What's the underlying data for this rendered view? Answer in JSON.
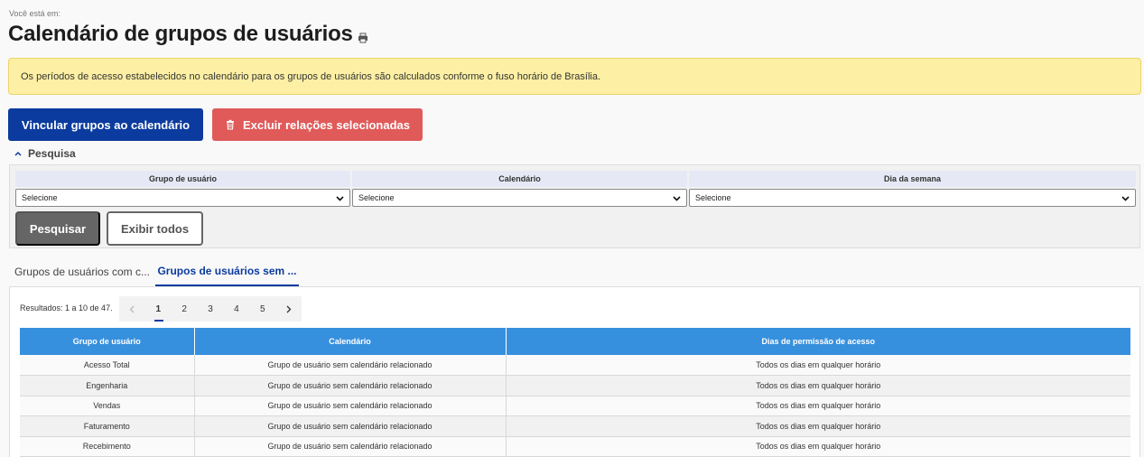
{
  "breadcrumb": "Você está em:",
  "page_title": "Calendário de grupos de usuários",
  "alert": "Os períodos de acesso estabelecidos no calendário para os grupos de usuários são calculados conforme o fuso horário de Brasília.",
  "actions": {
    "link_label": "Vincular grupos ao calendário",
    "delete_label": "Excluir relações selecionadas"
  },
  "search": {
    "toggle_label": "Pesquisa",
    "filters": [
      {
        "label": "Grupo de usuário",
        "value": "Selecione"
      },
      {
        "label": "Calendário",
        "value": "Selecione"
      },
      {
        "label": "Dia da semana",
        "value": "Selecione"
      }
    ],
    "search_label": "Pesquisar",
    "show_all_label": "Exibir todos"
  },
  "tabs": [
    {
      "label": "Grupos de usuários com c..."
    },
    {
      "label": "Grupos de usuários sem ..."
    }
  ],
  "results_text": "Resultados: 1 a 10 de 47.",
  "pagination": {
    "pages": [
      "1",
      "2",
      "3",
      "4",
      "5"
    ],
    "current": "1"
  },
  "table": {
    "headers": [
      "Grupo de usuário",
      "Calendário",
      "Dias de permissão de acesso"
    ],
    "rows": [
      [
        "Acesso Total",
        "Grupo de usuário sem calendário relacionado",
        "Todos os dias em qualquer horário"
      ],
      [
        "Engenharia",
        "Grupo de usuário sem calendário relacionado",
        "Todos os dias em qualquer horário"
      ],
      [
        "Vendas",
        "Grupo de usuário sem calendário relacionado",
        "Todos os dias em qualquer horário"
      ],
      [
        "Faturamento",
        "Grupo de usuário sem calendário relacionado",
        "Todos os dias em qualquer horário"
      ],
      [
        "Recebimento",
        "Grupo de usuário sem calendário relacionado",
        "Todos os dias em qualquer horário"
      ]
    ]
  },
  "colors": {
    "primary": "#0b3b9e",
    "danger": "#e05a5a",
    "alert_bg": "#fdf0a4",
    "table_header": "#3790dd"
  }
}
